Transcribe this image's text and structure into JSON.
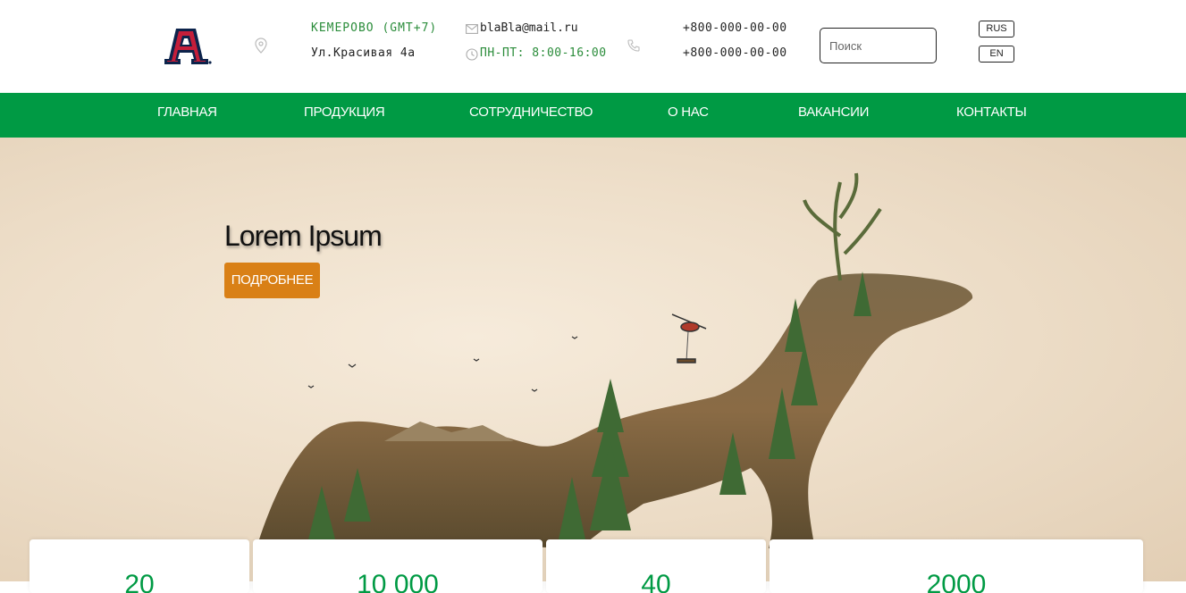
{
  "header": {
    "logo_icon": "university-a-logo",
    "location_icon": "map-pin-icon",
    "city": "КЕМЕРОВО (GMT+7)",
    "address": "Ул.Красивая 4а",
    "mail_icon": "envelope-icon",
    "email": "blaBla@mail.ru",
    "clock_icon": "clock-icon",
    "hours": "ПН-ПТ: 8:00-16:00",
    "phone_icon": "phone-icon",
    "phone1": "+800-000-00-00",
    "phone2": "+800-000-00-00",
    "search_placeholder": "Поиск",
    "lang_rus": "RUS",
    "lang_en": "EN"
  },
  "nav": {
    "items": [
      {
        "label": "ГЛАВНАЯ"
      },
      {
        "label": "ПРОДУКЦИЯ"
      },
      {
        "label": "СОТРУДНИЧЕСТВО"
      },
      {
        "label": "О НАС"
      },
      {
        "label": "ВАКАНСИИ"
      },
      {
        "label": "КОНТАКТЫ"
      }
    ]
  },
  "hero": {
    "title": "Lorem Ipsum",
    "button": "ПОДРОБНЕЕ",
    "image": "forest-deer-collage"
  },
  "stats": [
    {
      "value": "20"
    },
    {
      "value": "10 000"
    },
    {
      "value": "40"
    },
    {
      "value": "2000"
    }
  ],
  "colors": {
    "accent_green": "#009a44",
    "text_green": "#2a8c3a",
    "button_orange": "#d98016"
  }
}
